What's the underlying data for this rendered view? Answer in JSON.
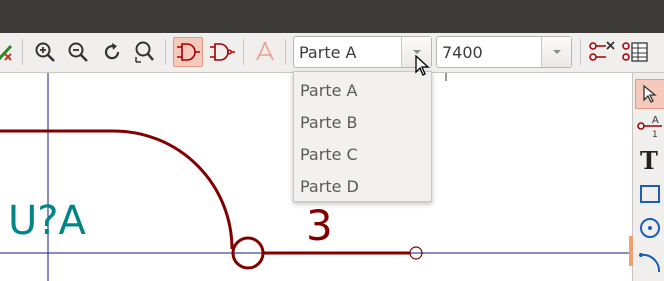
{
  "toolbar": {
    "icons": [
      "check-icon",
      "zoom-in-icon",
      "zoom-out-icon",
      "refresh-icon",
      "zoom-fit-icon",
      "gate-alt-icon",
      "gate-nand-icon",
      "pdf-icon",
      "delete-pin-icon",
      "table-icon"
    ],
    "unit_selector": {
      "value": "Parte A"
    },
    "symbol_selector": {
      "value": "7400"
    }
  },
  "dropdown": {
    "options": [
      "Parte A",
      "Parte B",
      "Parte C",
      "Parte D"
    ]
  },
  "schematic": {
    "reference": "U?A",
    "pin_number": "3"
  },
  "right_toolbar": {
    "icons": [
      "select-arrow-icon",
      "pin-icon",
      "text-icon",
      "rectangle-icon",
      "circle-icon",
      "arc-icon"
    ]
  },
  "colors": {
    "wire": "#800000",
    "reference_text": "#008484",
    "grid_line": "#1a1a8a"
  }
}
